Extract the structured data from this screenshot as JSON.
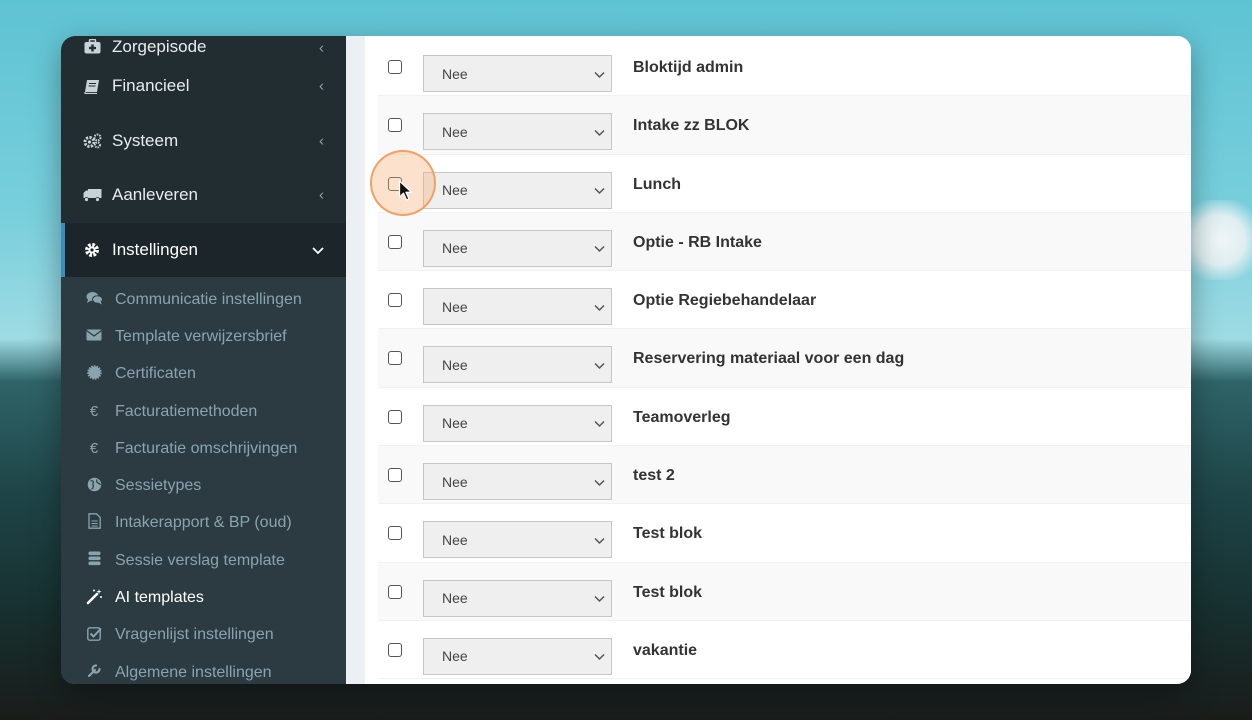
{
  "sidebar": {
    "main_items": [
      {
        "label": "Zorgepisode",
        "icon": "medkit-icon"
      },
      {
        "label": "Financieel",
        "icon": "book-icon"
      },
      {
        "label": "Systeem",
        "icon": "gears-icon"
      },
      {
        "label": "Aanleveren",
        "icon": "truck-icon"
      },
      {
        "label": "Instellingen",
        "icon": "gear-icon",
        "active": true
      }
    ],
    "sub_items": [
      {
        "label": "Communicatie instellingen",
        "icon": "comments-icon"
      },
      {
        "label": "Template verwijzersbrief",
        "icon": "envelope-icon"
      },
      {
        "label": "Certificaten",
        "icon": "certificate-icon"
      },
      {
        "label": "Facturatiemethoden",
        "icon": "euro-icon"
      },
      {
        "label": "Facturatie omschrijvingen",
        "icon": "euro-icon"
      },
      {
        "label": "Sessietypes",
        "icon": "globe-icon"
      },
      {
        "label": "Intakerapport & BP (oud)",
        "icon": "file-icon"
      },
      {
        "label": "Sessie verslag template",
        "icon": "database-icon"
      },
      {
        "label": "AI templates",
        "icon": "magic-wand-icon",
        "current": true
      },
      {
        "label": "Vragenlijst instellingen",
        "icon": "check-square-icon"
      },
      {
        "label": "Algemene instellingen",
        "icon": "wrench-icon"
      }
    ]
  },
  "table": {
    "rows": [
      {
        "select": "Nee",
        "label": "Bloktijd admin"
      },
      {
        "select": "Nee",
        "label": "Intake zz BLOK"
      },
      {
        "select": "Nee",
        "label": "Lunch"
      },
      {
        "select": "Nee",
        "label": "Optie - RB Intake"
      },
      {
        "select": "Nee",
        "label": "Optie Regiebehandelaar"
      },
      {
        "select": "Nee",
        "label": "Reservering materiaal voor een dag"
      },
      {
        "select": "Nee",
        "label": "Teamoverleg"
      },
      {
        "select": "Nee",
        "label": "test 2"
      },
      {
        "select": "Nee",
        "label": "Test blok"
      },
      {
        "select": "Nee",
        "label": "Test blok"
      },
      {
        "select": "Nee",
        "label": "vakantie"
      }
    ]
  },
  "colors": {
    "sidebar_bg": "#222d32",
    "submenu_bg": "#2c3b41",
    "accent": "#3c8dbc",
    "click_highlight": "#f5aa6e"
  }
}
